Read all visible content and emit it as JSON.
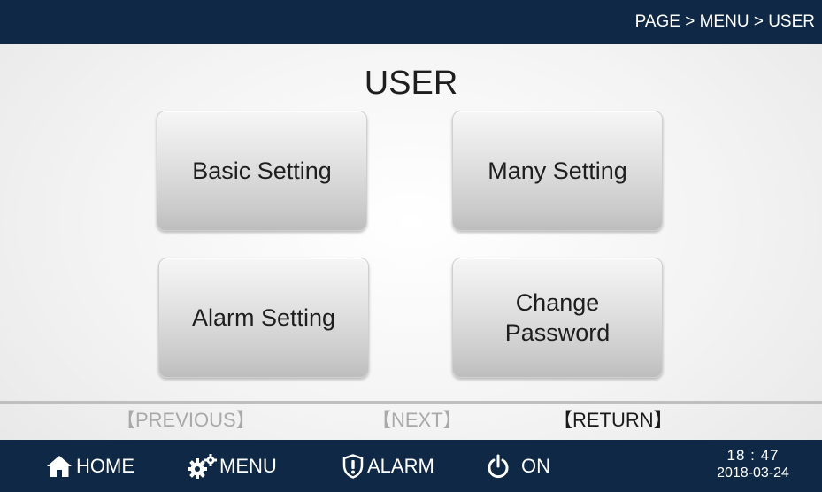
{
  "header": {
    "breadcrumb": "PAGE > MENU > USER"
  },
  "main": {
    "title": "USER",
    "buttons": {
      "basic_setting": "Basic Setting",
      "many_setting": "Many Setting",
      "alarm_setting": "Alarm Setting",
      "change_password": "Change\nPassword"
    }
  },
  "pager": {
    "previous": "【PREVIOUS】",
    "next": "【NEXT】",
    "return": "【RETURN】"
  },
  "footer": {
    "home": "HOME",
    "menu": "MENU",
    "alarm": "ALARM",
    "power": "ON",
    "time": "18 : 47",
    "date": "2018-03-24"
  },
  "colors": {
    "bar_background": "#0f2845",
    "disabled_text": "#a9a9a9"
  },
  "icons": {
    "home": "home-icon",
    "menu": "gears-icon",
    "alarm": "shield-alert-icon",
    "power": "power-icon"
  }
}
